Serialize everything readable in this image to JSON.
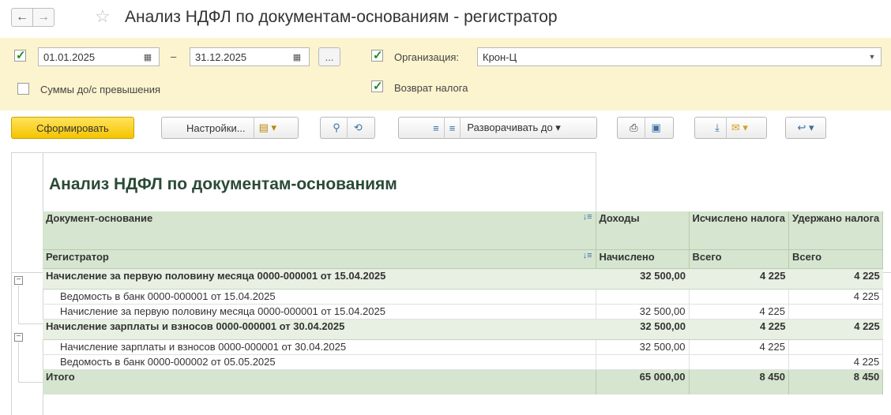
{
  "window": {
    "title": "Анализ НДФЛ по документам-основаниям - регистратор"
  },
  "filters": {
    "period_enabled": true,
    "date_from": "01.01.2025",
    "date_sep": "–",
    "date_to": "31.12.2025",
    "more_label": "...",
    "org_enabled": true,
    "org_label": "Организация:",
    "org_value": "Крон-Ц",
    "sums_label": "Суммы до/с превышения",
    "sums_checked": false,
    "refund_label": "Возврат налога",
    "refund_checked": true
  },
  "toolbar": {
    "generate": "Сформировать",
    "settings": "Настройки...",
    "expand_to": "Разворачивать до"
  },
  "report": {
    "title": "Анализ НДФЛ по документам-основаниям",
    "header1": [
      "Документ-основание",
      "Доходы",
      "Исчислено налога",
      "Удержано налога"
    ],
    "header2": [
      "Регистратор",
      "Начислено",
      "Всего",
      "Всего"
    ],
    "groups": [
      {
        "name": "Начисление за первую половину месяца 0000-000001 от 15.04.2025",
        "income": "32 500,00",
        "calc": "4 225",
        "withheld": "4 225",
        "rows": [
          {
            "name": "Ведомость в банк 0000-000001 от 15.04.2025",
            "income": "",
            "calc": "",
            "withheld": "4 225"
          },
          {
            "name": "Начисление за первую половину месяца 0000-000001 от 15.04.2025",
            "income": "32 500,00",
            "calc": "4 225",
            "withheld": ""
          }
        ]
      },
      {
        "name": "Начисление зарплаты и взносов 0000-000001 от 30.04.2025",
        "income": "32 500,00",
        "calc": "4 225",
        "withheld": "4 225",
        "rows": [
          {
            "name": "Начисление зарплаты и взносов 0000-000001 от 30.04.2025",
            "income": "32 500,00",
            "calc": "4 225",
            "withheld": ""
          },
          {
            "name": "Ведомость в банк 0000-000002 от 05.05.2025",
            "income": "",
            "calc": "",
            "withheld": "4 225"
          }
        ]
      }
    ],
    "total": {
      "label": "Итого",
      "income": "65 000,00",
      "calc": "8 450",
      "withheld": "8 450"
    }
  }
}
